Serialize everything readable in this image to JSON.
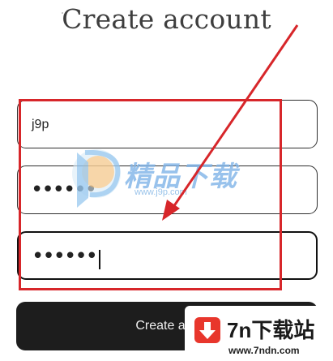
{
  "page": {
    "title": "Create account"
  },
  "form": {
    "username_value": "j9p",
    "password_value": "••••••",
    "confirm_password_value": "••••••",
    "submit_label": "Create acc"
  },
  "watermark": {
    "site_name": "精品下载",
    "site_url": "www.j9p.com"
  },
  "badge": {
    "site_name": "7n下载站",
    "site_url": "www.7ndn.com"
  },
  "colors": {
    "annotation_red": "#d7262a",
    "button_bg": "#1d1d1d",
    "watermark_blue": "#7fb3e8",
    "badge_red": "#e8362c"
  }
}
